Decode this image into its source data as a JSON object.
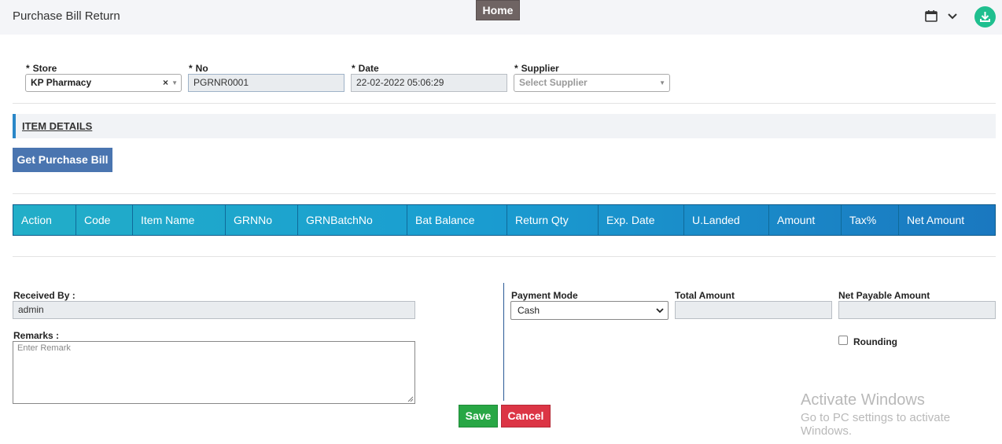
{
  "header": {
    "title": "Purchase Bill Return",
    "home_tab": "Home",
    "icons": [
      "calendar-icon",
      "chevron-down-icon",
      "download-icon"
    ]
  },
  "form": {
    "store": {
      "label": "Store",
      "value": "KP Pharmacy"
    },
    "no": {
      "label": "No",
      "value": "PGRNR0001"
    },
    "date": {
      "label": "Date",
      "value": "22-02-2022 05:06:29"
    },
    "supplier": {
      "label": "Supplier",
      "placeholder": "Select Supplier"
    },
    "required_mark": "*"
  },
  "item_details": {
    "title": "ITEM DETAILS",
    "get_bill_button": "Get Purchase Bill",
    "columns": [
      "Action",
      "Code",
      "Item Name",
      "GRNNo",
      "GRNBatchNo",
      "Bat Balance",
      "Return Qty",
      "Exp. Date",
      "U.Landed",
      "Amount",
      "Tax%",
      "Net Amount"
    ]
  },
  "footer": {
    "received_by": {
      "label": "Received By :",
      "value": "admin"
    },
    "remarks": {
      "label": "Remarks :",
      "placeholder": "Enter Remark"
    },
    "payment_mode": {
      "label": "Payment Mode",
      "value": "Cash"
    },
    "total_amount": {
      "label": "Total Amount",
      "value": ""
    },
    "net_payable": {
      "label": "Net Payable Amount",
      "value": ""
    },
    "rounding": {
      "label": "Rounding",
      "checked": false
    }
  },
  "actions": {
    "save": "Save",
    "cancel": "Cancel"
  },
  "watermark": {
    "line1": "Activate Windows",
    "line2": "Go to PC settings to activate Windows."
  },
  "colors": {
    "grid_header": "#1a9ed1",
    "get_bill_button": "#4a75b0",
    "save": "#28a745",
    "cancel": "#dc3545",
    "home_tab": "#6f6463",
    "download": "#1fbf8f"
  }
}
